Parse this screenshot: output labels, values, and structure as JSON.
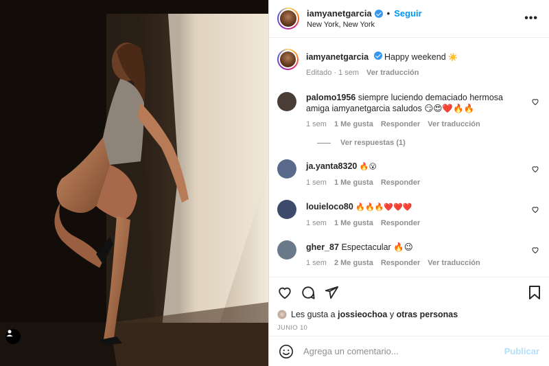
{
  "post": {
    "username": "iamyanetgarcia",
    "separator": "•",
    "follow_label": "Seguir",
    "location": "New York, New York",
    "more_icon": "more-horizontal-icon"
  },
  "caption": {
    "username": "iamyanetgarcia",
    "text": "Happy weekend",
    "emoji": "☀️",
    "edited": "Editado · 1 sem",
    "translate": "Ver traducción"
  },
  "comments": [
    {
      "username": "palomo1956",
      "text": "siempre luciendo demaciado hermosa amiga iamyanetgarcia saludos 😏😍❤️🔥🔥",
      "time": "1 sem",
      "likes": "1 Me gusta",
      "reply": "Responder",
      "translate": "Ver traducción",
      "avatar_color": "#4a3d35"
    },
    {
      "username": "ja.yanta8320",
      "text": "🔥😮",
      "time": "1 sem",
      "likes": "1 Me gusta",
      "reply": "Responder",
      "avatar_color": "#5a6a8a"
    },
    {
      "username": "louieloco80",
      "text": "🔥🔥🔥❤️❤️❤️",
      "time": "1 sem",
      "likes": "1 Me gusta",
      "reply": "Responder",
      "avatar_color": "#3d4a6a"
    },
    {
      "username": "gher_87",
      "text": "Espectacular 🔥😉",
      "time": "1 sem",
      "likes": "2 Me gusta",
      "reply": "Responder",
      "translate": "Ver traducción",
      "avatar_color": "#6a7a8a"
    }
  ],
  "replies_label": "Ver respuestas (1)",
  "liked_by": {
    "prefix": "Les gusta a",
    "user": "jossieochoa",
    "middle": "y",
    "others": "otras personas"
  },
  "date": "JUNIO 10",
  "add_comment": {
    "placeholder": "Agrega un comentario...",
    "publish_label": "Publicar"
  },
  "colors": {
    "accent": "#0095f6",
    "verified": "#3897f0",
    "muted": "#8e8e8e",
    "publish_disabled": "#b2dffc"
  }
}
